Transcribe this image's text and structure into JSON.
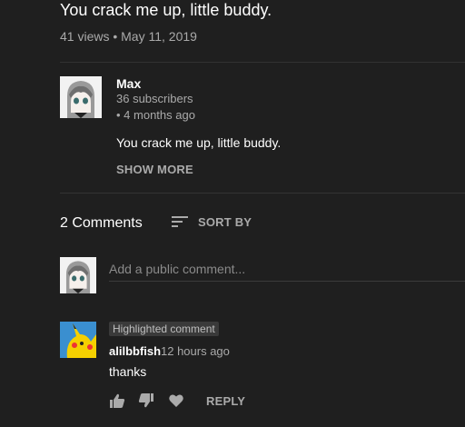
{
  "video": {
    "title": "You crack me up, little buddy.",
    "meta": "41 views • May 11, 2019"
  },
  "channel": {
    "name": "Max",
    "subscribers": "36 subscribers",
    "time": "• 4 months ago",
    "description": "You crack me up, little buddy.",
    "show_more": "SHOW MORE"
  },
  "comments_header": {
    "count": "2 Comments",
    "sort_label": "SORT BY"
  },
  "add_comment": {
    "placeholder": "Add a public comment..."
  },
  "comment": {
    "badge": "Highlighted comment",
    "author": "alilbbfish",
    "time": "12 hours ago",
    "text": "thanks",
    "reply_label": "REPLY"
  },
  "icons": {
    "sort": "sort-icon",
    "like": "thumbs-up-icon",
    "dislike": "thumbs-down-icon",
    "heart": "heart-icon"
  }
}
